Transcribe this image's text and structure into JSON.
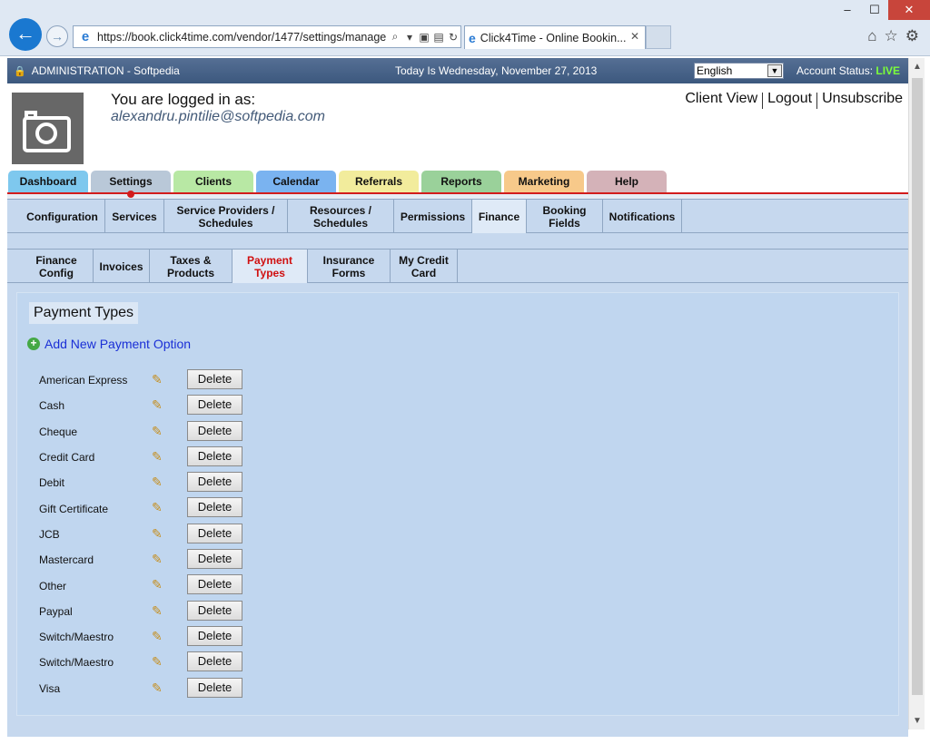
{
  "browser": {
    "url": "https://book.click4time.com/vendor/1477/settings/manage",
    "tab_title": "Click4Time - Online Bookin...",
    "tab_close": "✕",
    "window_controls": [
      "–",
      "☐",
      "✕"
    ],
    "tools_icons": [
      "home-icon",
      "star-icon",
      "gear-icon"
    ]
  },
  "admin_bar": {
    "title": "ADMINISTRATION - Softpedia",
    "date": "Today Is Wednesday, November 27, 2013",
    "language": "English",
    "status_label": "Account Status:",
    "status_value": "LIVE"
  },
  "user": {
    "logged_label": "You are logged in as:",
    "email": "alexandru.pintilie@softpedia.com",
    "links": [
      "Client View",
      "Logout",
      "Unsubscribe"
    ]
  },
  "main_tabs": [
    {
      "label": "Dashboard",
      "color": "#7ec8ee"
    },
    {
      "label": "Settings",
      "color": "#b9c8d8",
      "active": true
    },
    {
      "label": "Clients",
      "color": "#b8e8a4"
    },
    {
      "label": "Calendar",
      "color": "#7ab3f0"
    },
    {
      "label": "Referrals",
      "color": "#f2ec9c"
    },
    {
      "label": "Reports",
      "color": "#9ad19a"
    },
    {
      "label": "Marketing",
      "color": "#f7c98a"
    },
    {
      "label": "Help",
      "color": "#d4b2b8"
    }
  ],
  "settings_tabs": [
    "Configuration",
    "Services",
    "Service Providers /\nSchedules",
    "Resources /\nSchedules",
    "Permissions",
    "Finance",
    "Booking\nFields",
    "Notifications"
  ],
  "finance_tabs": [
    "Finance\nConfig",
    "Invoices",
    "Taxes &\nProducts",
    "Payment\nTypes",
    "Insurance\nForms",
    "My Credit\nCard"
  ],
  "panel": {
    "title": "Payment Types",
    "add_link": "Add New Payment Option",
    "delete_label": "Delete",
    "payment_types": [
      "American Express",
      "Cash",
      "Cheque",
      "Credit Card",
      "Debit",
      "Gift Certificate",
      "JCB",
      "Mastercard",
      "Other",
      "Paypal",
      "Switch/Maestro",
      "Switch/Maestro",
      "Visa"
    ]
  }
}
